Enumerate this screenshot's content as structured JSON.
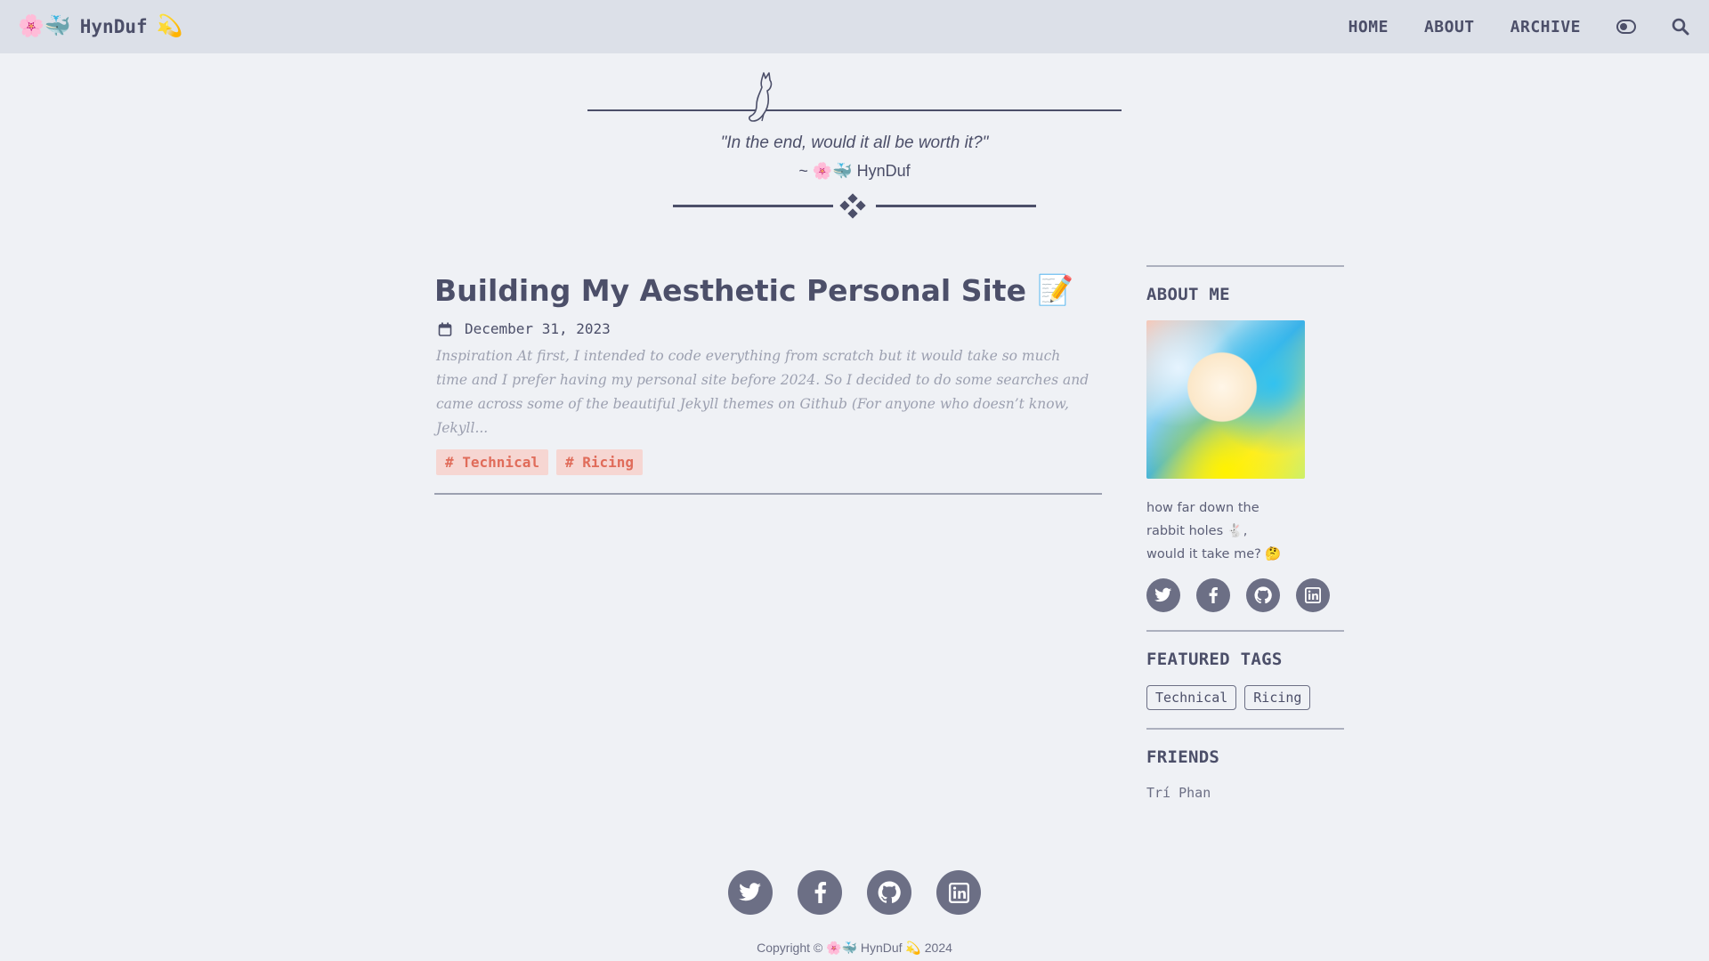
{
  "nav": {
    "brand_emoji_left": "🌸🐳",
    "brand_name": "HynDuf",
    "brand_emoji_right": "💫",
    "links": [
      "HOME",
      "ABOUT",
      "ARCHIVE"
    ],
    "theme_toggle_icon": "toggle-icon",
    "search_icon": "search-icon"
  },
  "hero": {
    "quote": "\"In the end, would it all be worth it?\"",
    "author": "~ 🌸🐳 HynDuf"
  },
  "post": {
    "title": "Building My Aesthetic Personal Site",
    "title_emoji": "📝",
    "date": "December 31, 2023",
    "excerpt": "Inspiration At first, I intended to code everything from scratch but it would take so much time and I prefer having my personal site before 2024. So I decided to do some searches and came across some of the beautiful Jekyll themes on Github (For anyone who doesn’t know, Jekyll...",
    "tags": [
      "# Technical",
      "# Ricing"
    ]
  },
  "sidebar": {
    "about_heading": "ABOUT ME",
    "bio_lines": [
      "how far down the",
      "rabbit holes 🐇,",
      "would it take me? 🤔"
    ],
    "social_icons": [
      "twitter-icon",
      "facebook-icon",
      "github-icon",
      "linkedin-icon"
    ],
    "featured_heading": "FEATURED TAGS",
    "featured_tags": [
      "Technical",
      "Ricing"
    ],
    "friends_heading": "FRIENDS",
    "friends": [
      "Trí Phan"
    ]
  },
  "footer": {
    "social_icons": [
      "twitter-icon",
      "facebook-icon",
      "github-icon",
      "linkedin-icon"
    ],
    "copyright": "Copyright © 🌸🐳 HynDuf 💫 2024"
  },
  "colors": {
    "background": "#eff1f5",
    "navbar": "#dce0e8",
    "text": "#4c4f69",
    "tag_bg": "#f6d6d2",
    "tag_text": "#e06c5a",
    "icon_circle": "#6c6f85"
  }
}
